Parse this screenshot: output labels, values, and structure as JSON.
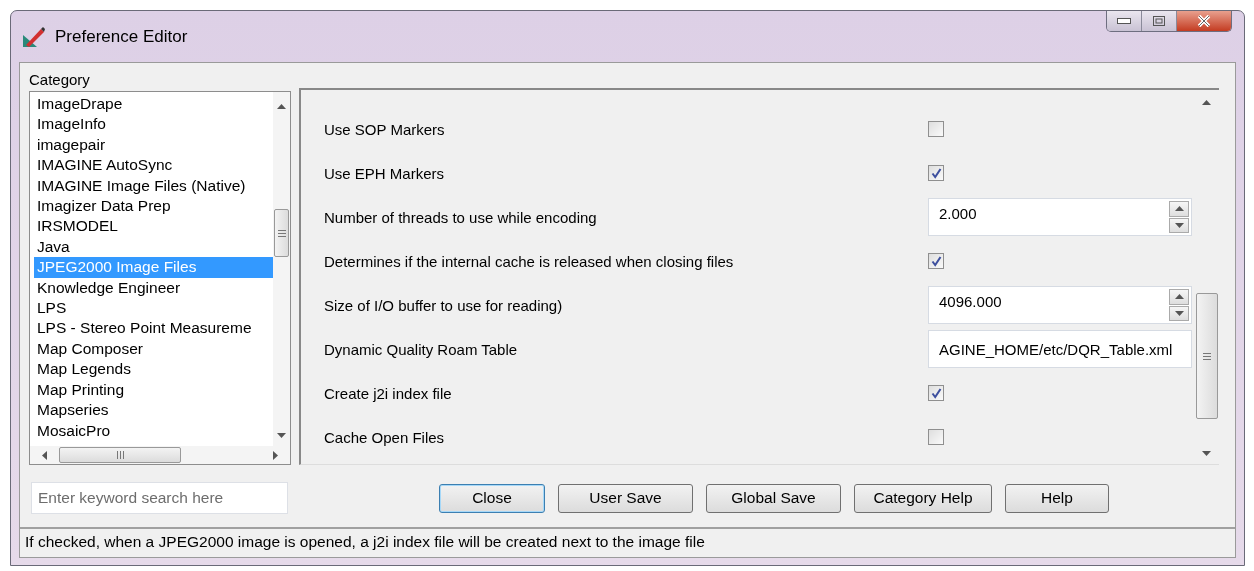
{
  "window": {
    "title": "Preference Editor"
  },
  "category": {
    "label": "Category",
    "items": [
      {
        "label": "ImageDrape",
        "selected": false
      },
      {
        "label": "ImageInfo",
        "selected": false
      },
      {
        "label": "imagepair",
        "selected": false
      },
      {
        "label": "IMAGINE AutoSync",
        "selected": false
      },
      {
        "label": "IMAGINE Image Files (Native)",
        "selected": false
      },
      {
        "label": "Imagizer Data Prep",
        "selected": false
      },
      {
        "label": "IRSMODEL",
        "selected": false
      },
      {
        "label": "Java",
        "selected": false
      },
      {
        "label": "JPEG2000 Image Files",
        "selected": true
      },
      {
        "label": "Knowledge Engineer",
        "selected": false
      },
      {
        "label": "LPS",
        "selected": false
      },
      {
        "label": "LPS - Stereo Point Measureme",
        "selected": false
      },
      {
        "label": "Map Composer",
        "selected": false
      },
      {
        "label": "Map Legends",
        "selected": false
      },
      {
        "label": "Map Printing",
        "selected": false
      },
      {
        "label": "Mapseries",
        "selected": false
      },
      {
        "label": "MosaicPro",
        "selected": false
      }
    ]
  },
  "settings": [
    {
      "kind": "checkbox",
      "label": "Use SOP Markers",
      "checked": false
    },
    {
      "kind": "checkbox",
      "label": "Use EPH Markers",
      "checked": true
    },
    {
      "kind": "spin",
      "label": "Number of threads to use while encoding",
      "value": "2.000"
    },
    {
      "kind": "checkbox",
      "label": "Determines if the internal cache is released when closing files",
      "checked": true
    },
    {
      "kind": "spin",
      "label": "Size of I/O buffer to use for reading)",
      "value": "4096.000"
    },
    {
      "kind": "text",
      "label": "Dynamic Quality Roam Table",
      "value": "AGINE_HOME/etc/DQR_Table.xml"
    },
    {
      "kind": "checkbox",
      "label": "Create j2i index file",
      "checked": true
    },
    {
      "kind": "checkbox",
      "label": "Cache Open Files",
      "checked": false
    }
  ],
  "search": {
    "placeholder": "Enter keyword search here"
  },
  "buttons": [
    {
      "label": "Close",
      "default": true
    },
    {
      "label": "User Save",
      "default": false
    },
    {
      "label": "Global Save",
      "default": false
    },
    {
      "label": "Category Help",
      "default": false
    },
    {
      "label": "Help",
      "default": false
    }
  ],
  "status_bar": "If checked, when a JPEG2000 image is opened, a j2i index file will be created next to the image file"
}
